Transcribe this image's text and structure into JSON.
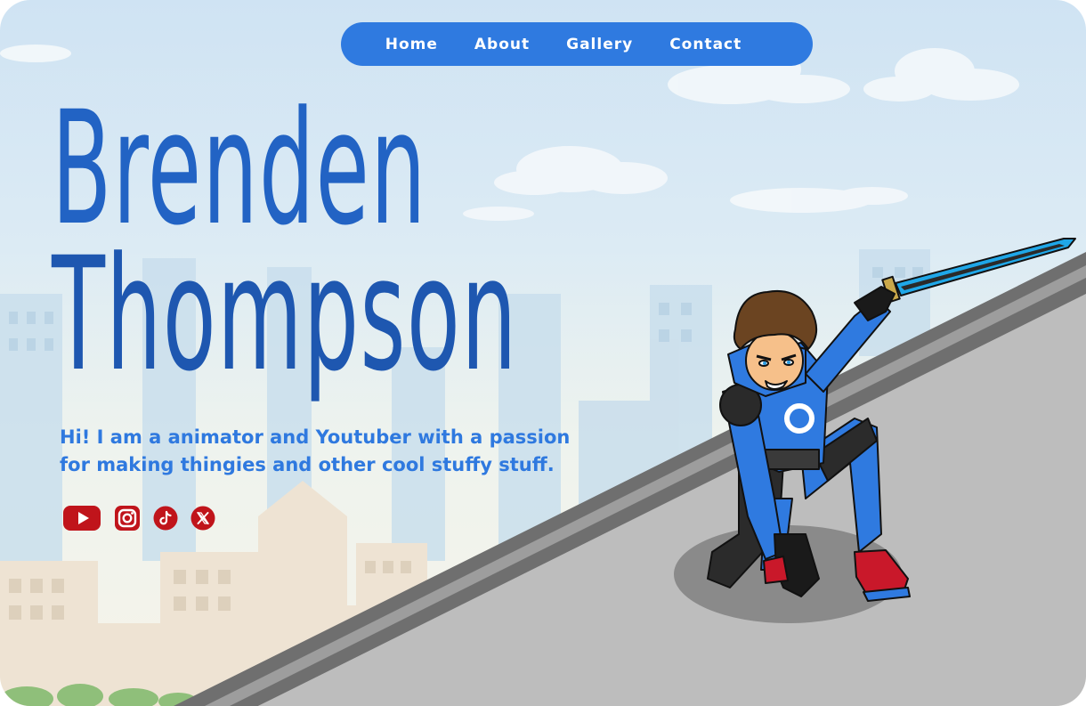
{
  "nav": {
    "items": [
      {
        "label": "Home"
      },
      {
        "label": "About"
      },
      {
        "label": "Gallery"
      },
      {
        "label": "Contact"
      }
    ]
  },
  "hero": {
    "name_line1": "Brenden",
    "name_line2": "Thompson",
    "tagline_line1": "Hi! I am a animator and Youtuber with a passion",
    "tagline_line2": "for making thingies and other cool stuffy stuff."
  },
  "socials": [
    {
      "icon": "youtube-icon"
    },
    {
      "icon": "instagram-icon"
    },
    {
      "icon": "tiktok-icon"
    },
    {
      "icon": "x-icon"
    }
  ],
  "colors": {
    "accent": "#2f7ae0",
    "title": "#1e5fc0",
    "social": "#c0141b",
    "hero_suit": "#2f7ae0"
  }
}
